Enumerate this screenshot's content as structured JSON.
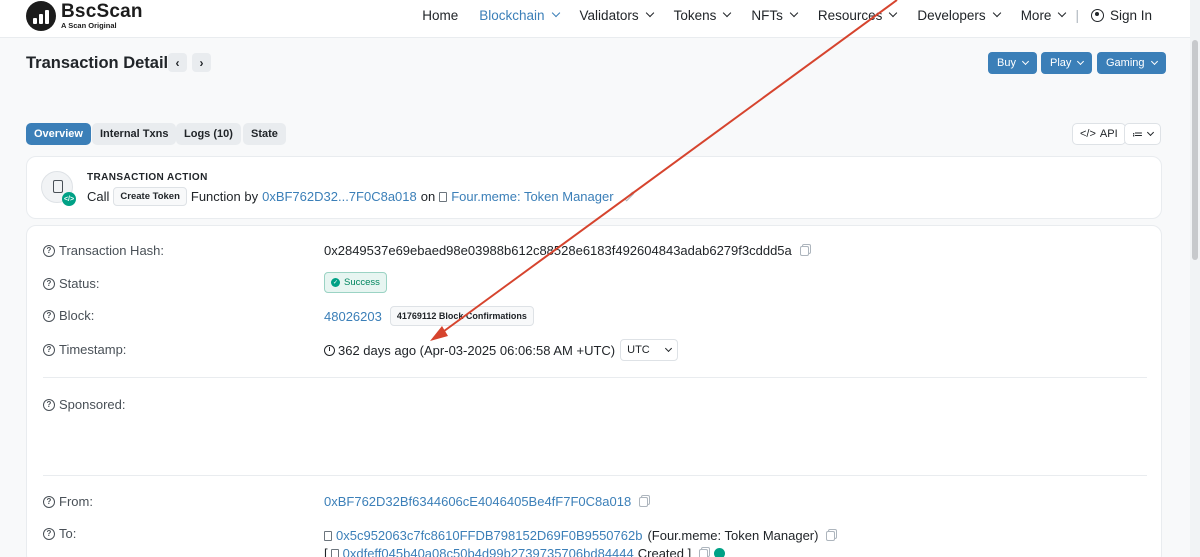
{
  "brand": {
    "name": "BscScan",
    "tagline": "A Scan Original"
  },
  "nav": {
    "items": [
      {
        "label": "Home",
        "dropdown": false
      },
      {
        "label": "Blockchain",
        "dropdown": true,
        "active": true
      },
      {
        "label": "Validators",
        "dropdown": true
      },
      {
        "label": "Tokens",
        "dropdown": true
      },
      {
        "label": "NFTs",
        "dropdown": true
      },
      {
        "label": "Resources",
        "dropdown": true
      },
      {
        "label": "Developers",
        "dropdown": true
      },
      {
        "label": "More",
        "dropdown": true
      }
    ],
    "separator": "|",
    "sign_in": "Sign In"
  },
  "page": {
    "title": "Transaction Details",
    "prev": "‹",
    "next": "›",
    "buttons": {
      "buy": "Buy",
      "play": "Play",
      "gaming": "Gaming"
    }
  },
  "tabs": [
    {
      "label": "Overview",
      "active": true
    },
    {
      "label": "Internal Txns"
    },
    {
      "label": "Logs (10)"
    },
    {
      "label": "State"
    }
  ],
  "tools": {
    "api": "API",
    "api_icon": "</>",
    "menu_icon": "≔"
  },
  "action": {
    "heading": "TRANSACTION ACTION",
    "call": "Call",
    "method": "Create Token",
    "function_by": "Function by",
    "from_short": "0xBF762D32...7F0C8a018",
    "on": "on",
    "contract": "Four.meme: Token Manager"
  },
  "details": {
    "hash_label": "Transaction Hash:",
    "hash": "0x2849537e69ebaed98e03988b612c88528e6183f492604843adab6279f3cddd5a",
    "status_label": "Status:",
    "status": "Success",
    "block_label": "Block:",
    "block": "48026203",
    "confirmations": "41769112 Block Confirmations",
    "timestamp_label": "Timestamp:",
    "timestamp": "362 days ago (Apr-03-2025 06:06:58 AM +UTC)",
    "tz": "UTC",
    "sponsored_label": "Sponsored:",
    "from_label": "From:",
    "from": "0xBF762D32Bf6344606cE4046405Be4fF7F0C8a018",
    "to_label": "To:",
    "to": "0x5c952063c7fc8610FFDB798152D69F0B9550762b",
    "to_name": "(Four.meme: Token Manager)",
    "created_prefix": "[",
    "created_addr": "0xdfeff045b40a08c50b4d99b2739735706bd84444",
    "created_suffix": "Created ]"
  },
  "colors": {
    "accent": "#3b7fb8",
    "success": "#00a186",
    "arrow": "#d6442e"
  }
}
